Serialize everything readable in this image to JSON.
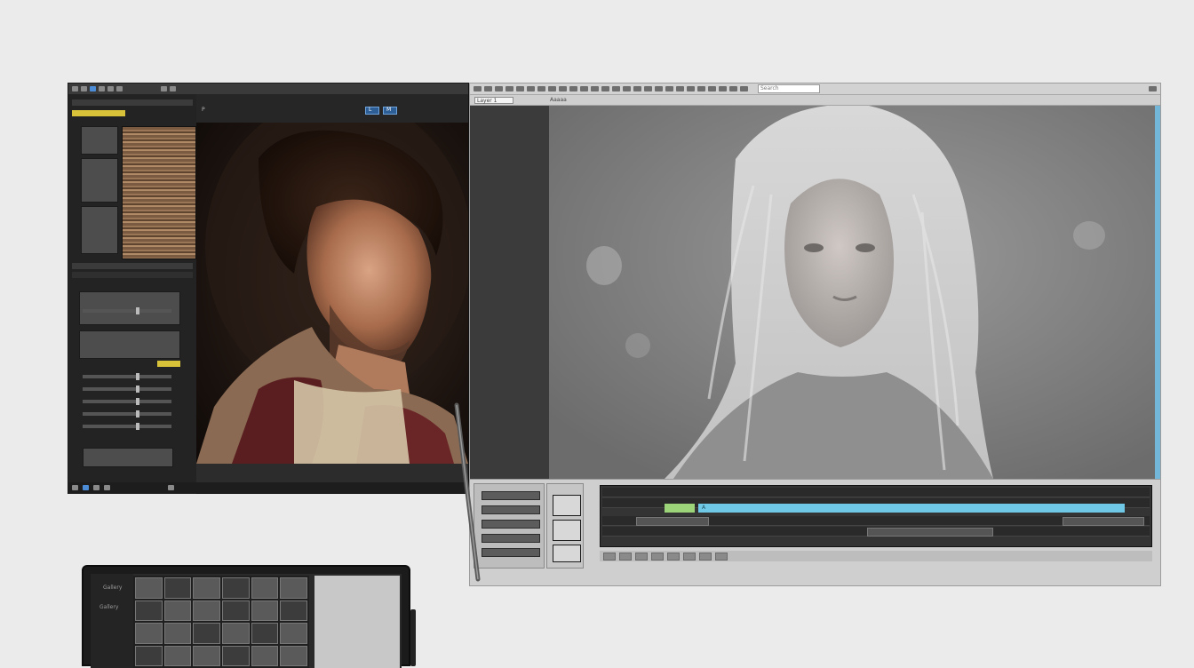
{
  "left_window": {
    "header_tab_1": "L",
    "header_tab_2": "M",
    "header_label": "P"
  },
  "right_window": {
    "search_placeholder": "Search",
    "tab_active": "Layer 1",
    "tab_second": "Aaaaa"
  },
  "timeline": {
    "track_label": "A"
  },
  "tablet": {
    "title": "Gallery",
    "subtitle": "Gallery"
  },
  "colors": {
    "accent_blue": "#4c8cd6",
    "timeline_cyan": "#6fc9e6",
    "timeline_green": "#9cd47a",
    "canvas_border": "#72b7da"
  },
  "icons": [
    "window-icon",
    "layer-icon",
    "search-icon",
    "play-icon",
    "timeline-icon",
    "stylus-icon"
  ]
}
